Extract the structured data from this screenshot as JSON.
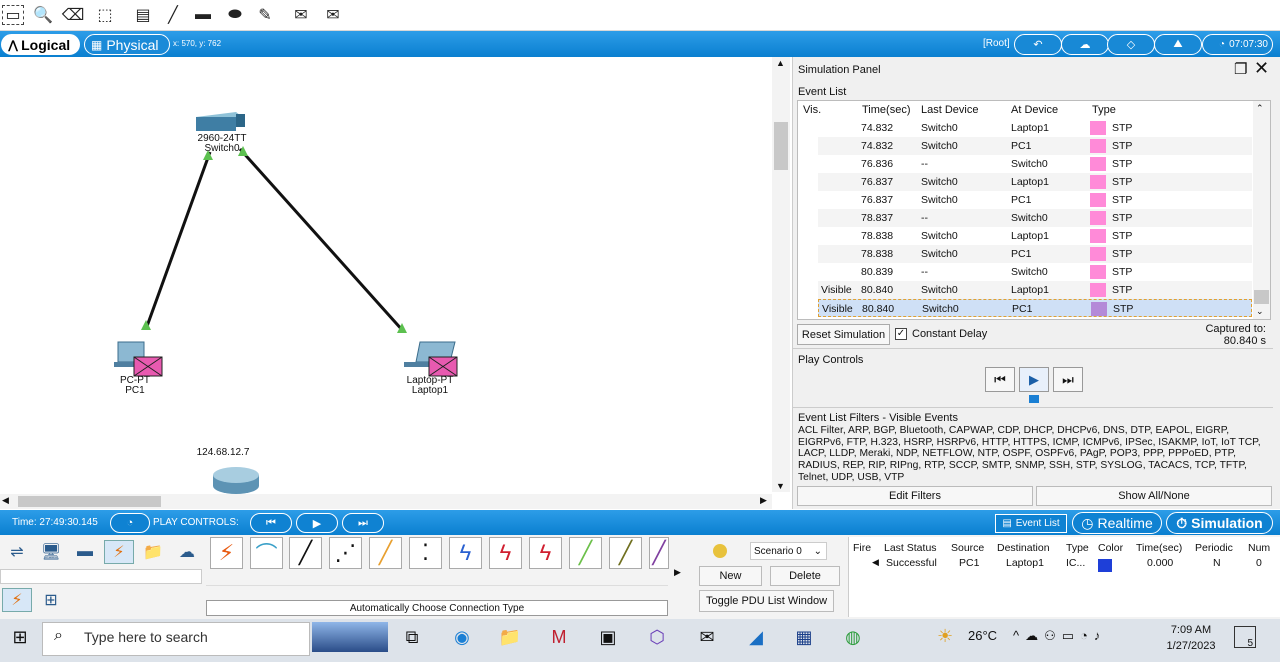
{
  "mode_bar": {
    "logical_label": "Logical",
    "physical_label": "Physical",
    "coords": "x: 570, y: 762",
    "root_label": "[Root]",
    "clock": "07:07:30"
  },
  "workspace": {
    "switch_label_1": "2960-24TT",
    "switch_label_2": "Switch0",
    "pc_label_1": "PC-PT",
    "pc_label_2": "PC1",
    "laptop_label_1": "Laptop-PT",
    "laptop_label_2": "Laptop1",
    "router_ip": "124.68.12.7"
  },
  "sim_panel": {
    "title": "Simulation Panel",
    "event_list_label": "Event List",
    "headers": [
      "Vis.",
      "Time(sec)",
      "Last Device",
      "At Device",
      "Type"
    ],
    "events": [
      {
        "vis": "",
        "time": "74.832",
        "last": "Switch0",
        "at": "Laptop1",
        "type": "STP"
      },
      {
        "vis": "",
        "time": "74.832",
        "last": "Switch0",
        "at": "PC1",
        "type": "STP"
      },
      {
        "vis": "",
        "time": "76.836",
        "last": "--",
        "at": "Switch0",
        "type": "STP"
      },
      {
        "vis": "",
        "time": "76.837",
        "last": "Switch0",
        "at": "Laptop1",
        "type": "STP"
      },
      {
        "vis": "",
        "time": "76.837",
        "last": "Switch0",
        "at": "PC1",
        "type": "STP"
      },
      {
        "vis": "",
        "time": "78.837",
        "last": "--",
        "at": "Switch0",
        "type": "STP"
      },
      {
        "vis": "",
        "time": "78.838",
        "last": "Switch0",
        "at": "Laptop1",
        "type": "STP"
      },
      {
        "vis": "",
        "time": "78.838",
        "last": "Switch0",
        "at": "PC1",
        "type": "STP"
      },
      {
        "vis": "",
        "time": "80.839",
        "last": "--",
        "at": "Switch0",
        "type": "STP"
      },
      {
        "vis": "Visible",
        "time": "80.840",
        "last": "Switch0",
        "at": "Laptop1",
        "type": "STP"
      },
      {
        "vis": "Visible",
        "time": "80.840",
        "last": "Switch0",
        "at": "PC1",
        "type": "STP"
      }
    ],
    "reset_label": "Reset Simulation",
    "constant_delay_label": "Constant Delay",
    "captured_label": "Captured to:",
    "captured_value": "80.840 s",
    "play_controls_label": "Play Controls",
    "filters_label": "Event List Filters - Visible Events",
    "filters_text": "ACL Filter, ARP, BGP, Bluetooth, CAPWAP, CDP, DHCP, DHCPv6, DNS, DTP, EAPOL, EIGRP, EIGRPv6, FTP, H.323, HSRP, HSRPv6, HTTP, HTTPS, ICMP, ICMPv6, IPSec, ISAKMP, IoT, IoT TCP, LACP, LLDP, Meraki, NDP, NETFLOW, NTP, OSPF, OSPFv6, PAgP, POP3, PPP, PPPoED, PTP, RADIUS, REP, RIP, RIPng, RTP, SCCP, SMTP, SNMP, SSH, STP, SYSLOG, TACACS, TCP, TFTP, Telnet, UDP, USB, VTP",
    "edit_filters_label": "Edit Filters",
    "show_all_label": "Show All/None"
  },
  "bottom_bar": {
    "time_label": "Time: 27:49:30.145",
    "play_controls_label": "PLAY CONTROLS:",
    "event_list_label": "Event List",
    "realtime_label": "Realtime",
    "simulation_label": "Simulation"
  },
  "palette": {
    "connection_type_label": "Automatically Choose Connection Type",
    "scenario_label": "Scenario 0",
    "new_label": "New",
    "delete_label": "Delete",
    "toggle_pdu_label": "Toggle PDU List Window"
  },
  "pdu_list": {
    "headers": [
      "Fire",
      "Last Status",
      "Source",
      "Destination",
      "Type",
      "Color",
      "Time(sec)",
      "Periodic",
      "Num"
    ],
    "row": {
      "last_status": "Successful",
      "source": "PC1",
      "destination": "Laptop1",
      "type": "IC...",
      "color": "#1e3fd8",
      "time": "0.000",
      "periodic": "N",
      "num": "0"
    }
  },
  "taskbar": {
    "search_placeholder": "Type here to search",
    "temperature": "26°C",
    "time": "7:09 AM",
    "date": "1/27/2023",
    "notification_count": "5"
  }
}
